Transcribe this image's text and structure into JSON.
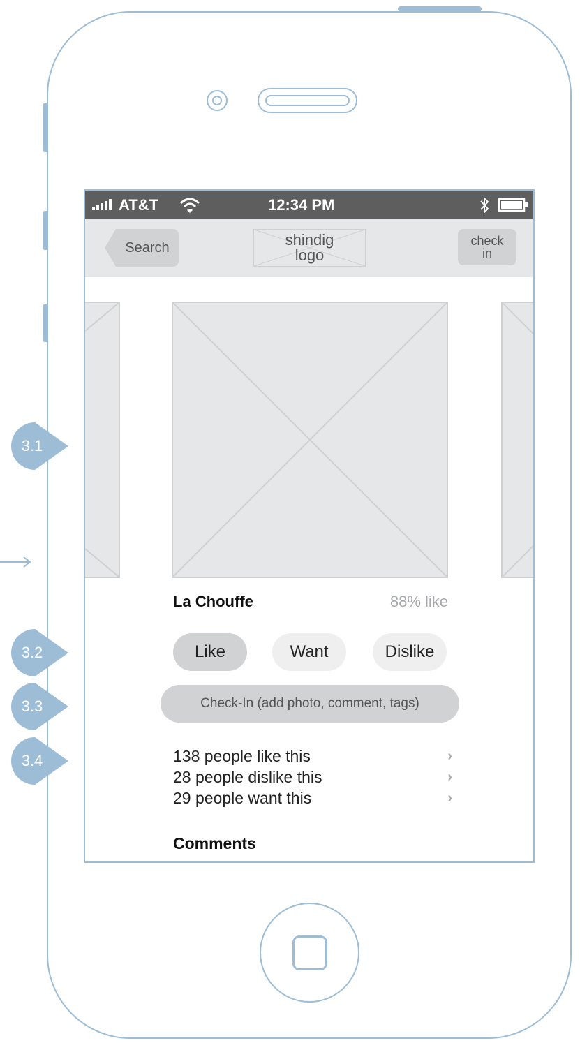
{
  "status_bar": {
    "carrier": "AT&T",
    "time": "12:34 PM"
  },
  "nav_bar": {
    "back_label": "Search",
    "logo_text": "shindig\nlogo",
    "check_in_label": "check\nin"
  },
  "beer": {
    "name": "La Chouffe",
    "rating": "88% like"
  },
  "actions": {
    "like": "Like",
    "want": "Want",
    "dislike": "Dislike"
  },
  "check_in_bar": "Check-In (add photo, comment, tags)",
  "stats": [
    {
      "label": "138 people like this"
    },
    {
      "label": "28 people dislike this"
    },
    {
      "label": "29 people want this"
    }
  ],
  "comments_heading": "Comments",
  "annotations": [
    "3.1",
    "3.2",
    "3.3",
    "3.4"
  ],
  "colors": {
    "outline": "#9dbdd6",
    "annotation": "#9dbdd6",
    "status_bar": "#5e5e5e",
    "placeholder": "#e6e7e8",
    "button": "#d1d2d3"
  }
}
